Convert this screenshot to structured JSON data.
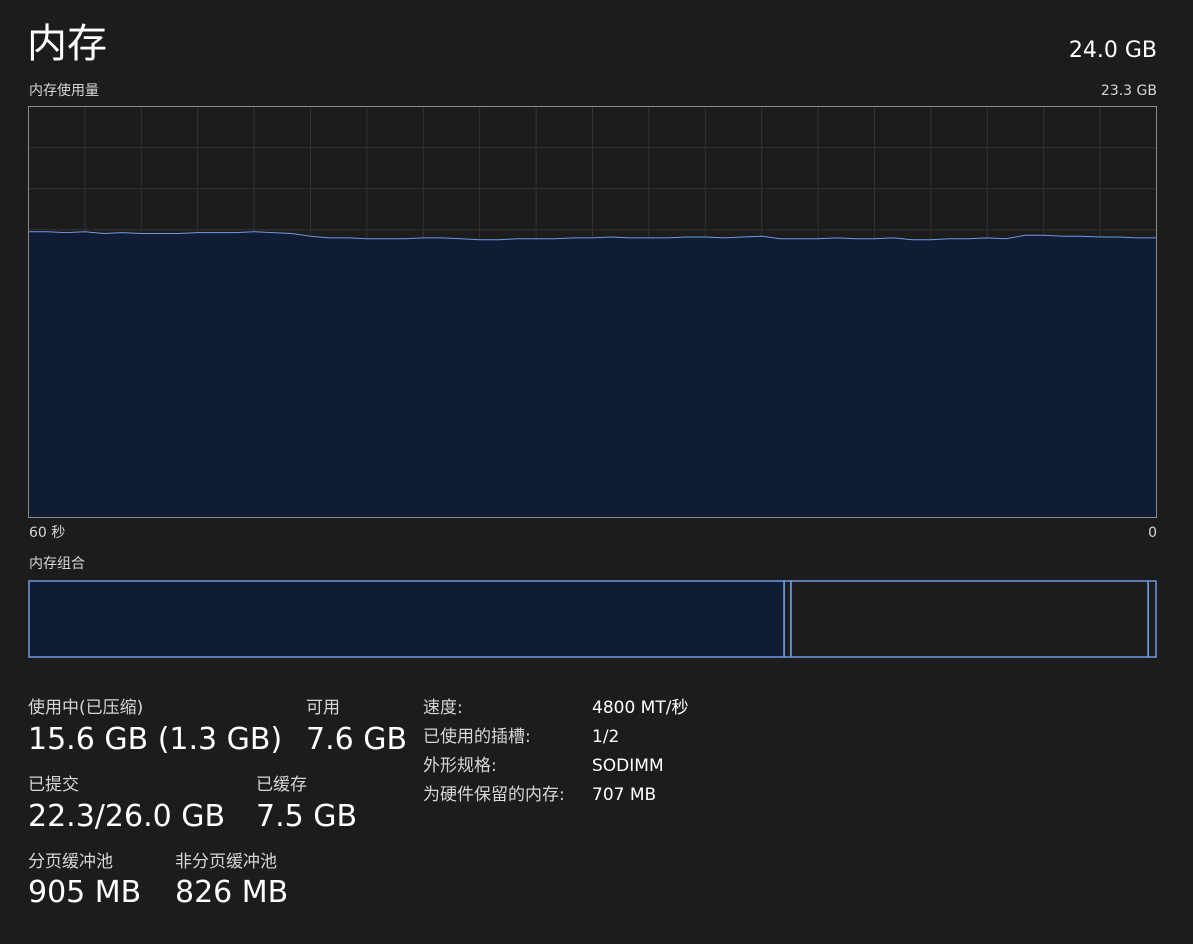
{
  "header": {
    "title": "内存",
    "total": "24.0 GB"
  },
  "usage_graph": {
    "label": "内存使用量",
    "max_label": "23.3 GB",
    "axis_left": "60 秒",
    "axis_right": "0",
    "line_color": "#6d99e0",
    "fill_color": "#0f1c33",
    "grid_color": "#333333",
    "border_color": "#8a8a8a"
  },
  "chart_data": {
    "type": "area",
    "title": "内存使用量",
    "x_label_start": "60 秒",
    "x_label_end": "0",
    "ylim": [
      0,
      23.3
    ],
    "y_unit": "GB",
    "grid": true,
    "x": [
      60,
      59,
      58,
      57,
      56,
      55,
      54,
      53,
      52,
      51,
      50,
      49,
      48,
      47,
      46,
      45,
      44,
      43,
      42,
      41,
      40,
      39,
      38,
      37,
      36,
      35,
      34,
      33,
      32,
      31,
      30,
      29,
      28,
      27,
      26,
      25,
      24,
      23,
      22,
      21,
      20,
      19,
      18,
      17,
      16,
      15,
      14,
      13,
      12,
      11,
      10,
      9,
      8,
      7,
      6,
      5,
      4,
      3,
      2,
      1,
      0
    ],
    "values": [
      16.2,
      16.2,
      16.15,
      16.2,
      16.1,
      16.15,
      16.1,
      16.1,
      16.1,
      16.15,
      16.15,
      16.15,
      16.2,
      16.15,
      16.1,
      15.95,
      15.85,
      15.85,
      15.8,
      15.8,
      15.8,
      15.85,
      15.85,
      15.8,
      15.75,
      15.75,
      15.8,
      15.8,
      15.8,
      15.85,
      15.85,
      15.9,
      15.85,
      15.85,
      15.85,
      15.9,
      15.9,
      15.85,
      15.9,
      15.95,
      15.8,
      15.8,
      15.8,
      15.85,
      15.8,
      15.8,
      15.85,
      15.75,
      15.75,
      15.8,
      15.8,
      15.85,
      15.8,
      16.0,
      16.0,
      15.95,
      15.95,
      15.9,
      15.9,
      15.85,
      15.85
    ]
  },
  "composition": {
    "label": "内存组合",
    "in_use_fraction": 0.67,
    "modified_fraction": 0.006,
    "standby_fraction": 0.317,
    "free_fraction": 0.007,
    "border_color": "#6d99e0",
    "fill_color": "#0f1c33"
  },
  "stats": {
    "in_use_label": "使用中(已压缩)",
    "in_use_value": "15.6 GB (1.3 GB)",
    "available_label": "可用",
    "available_value": "7.6 GB",
    "committed_label": "已提交",
    "committed_value": "22.3/26.0 GB",
    "cached_label": "已缓存",
    "cached_value": "7.5 GB",
    "paged_pool_label": "分页缓冲池",
    "paged_pool_value": "905 MB",
    "nonpaged_pool_label": "非分页缓冲池",
    "nonpaged_pool_value": "826 MB"
  },
  "properties": {
    "speed_label": "速度:",
    "speed_value": "4800 MT/秒",
    "slots_label": "已使用的插槽:",
    "slots_value": "1/2",
    "form_factor_label": "外形规格:",
    "form_factor_value": "SODIMM",
    "reserved_label": "为硬件保留的内存:",
    "reserved_value": "707 MB"
  }
}
